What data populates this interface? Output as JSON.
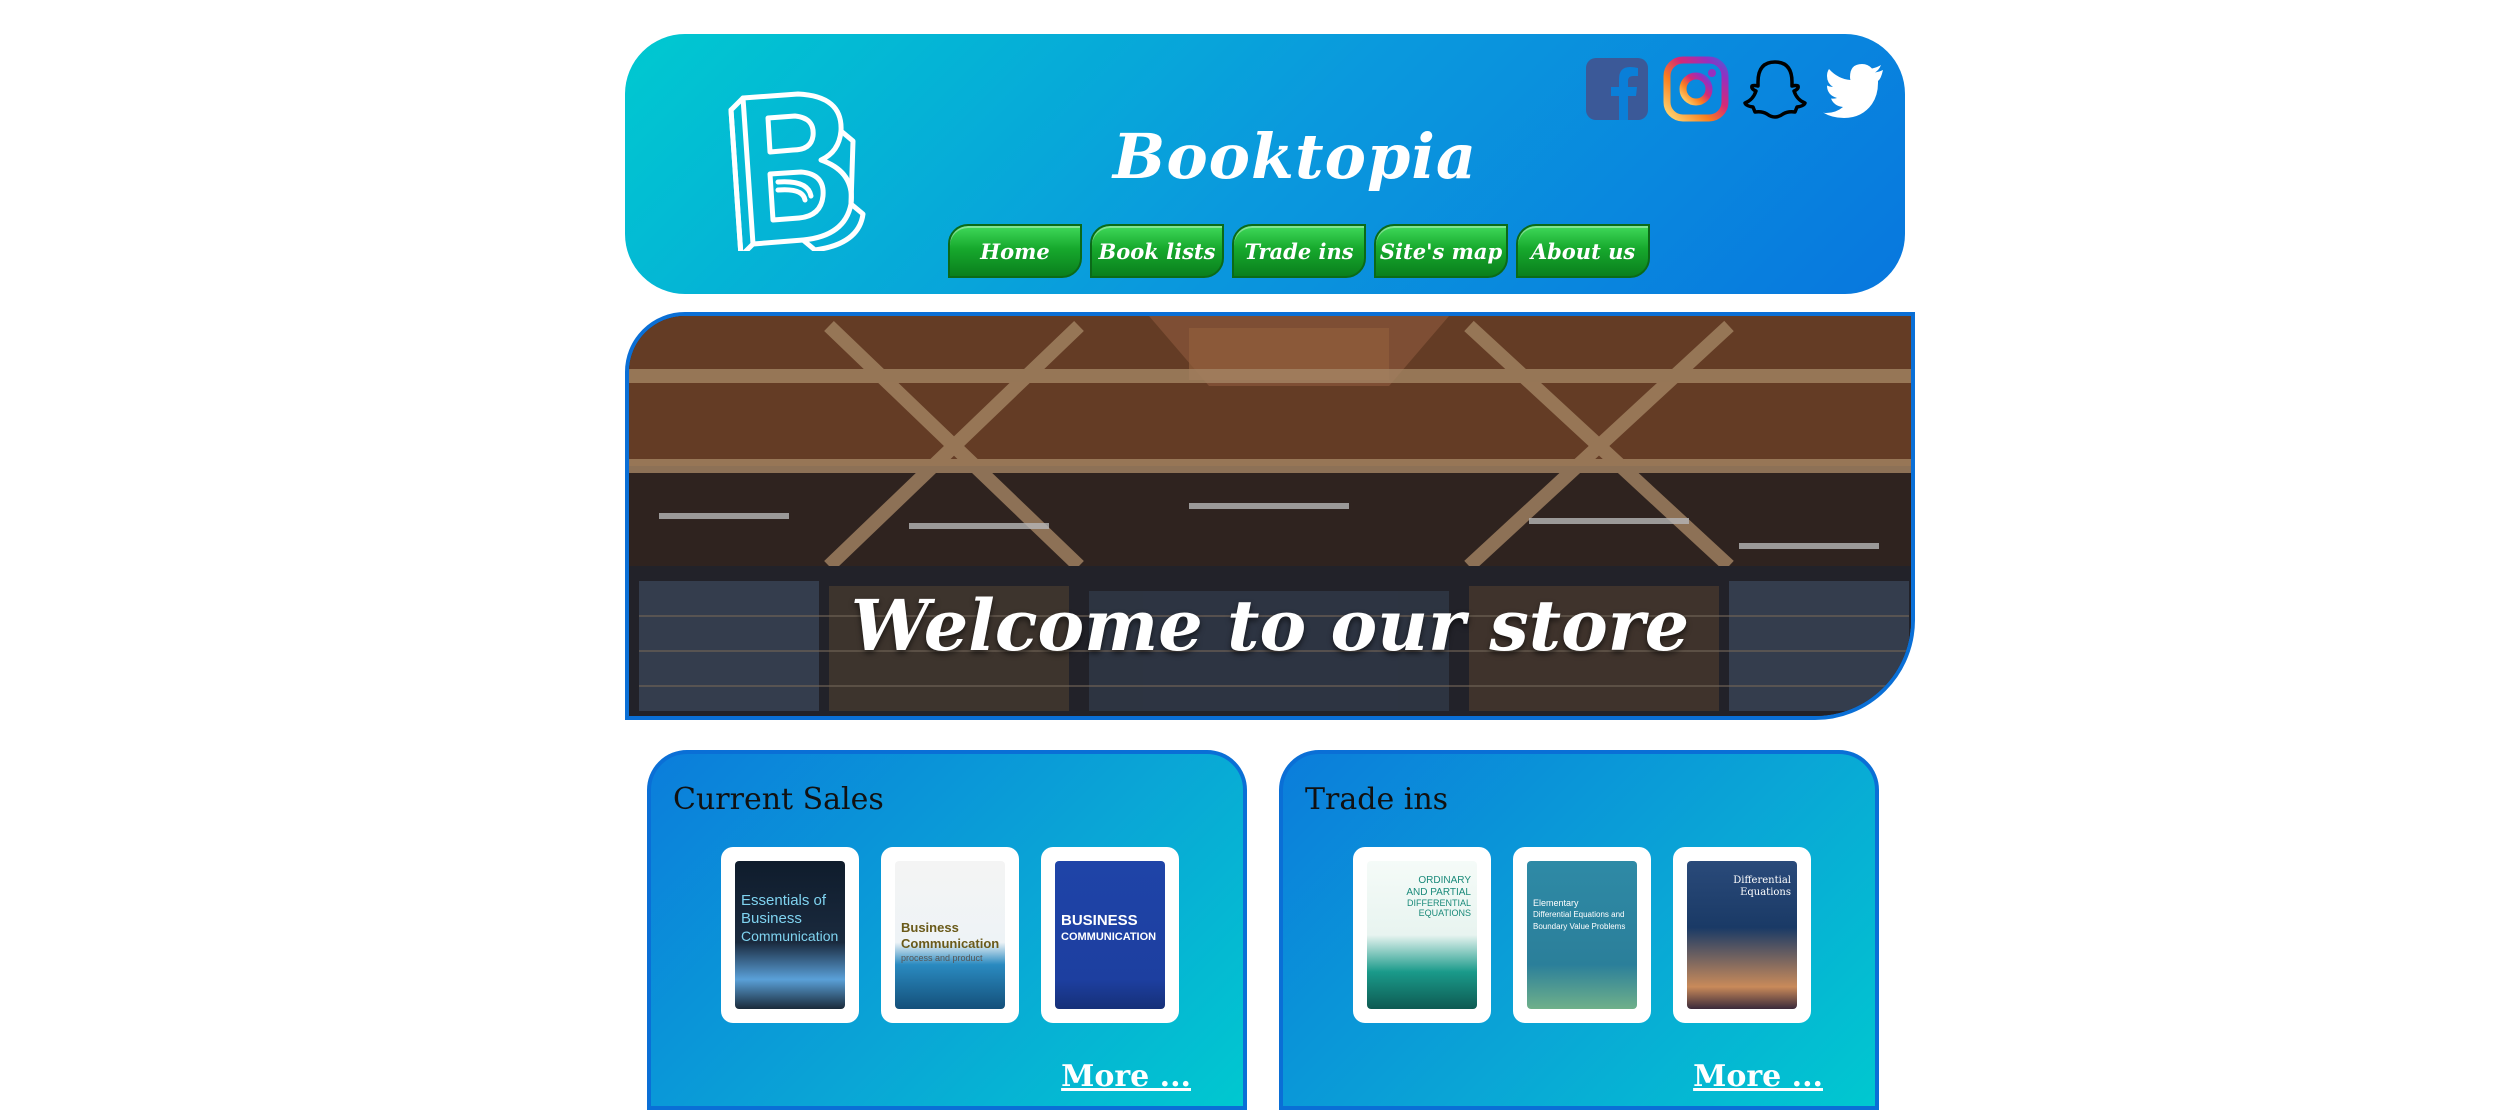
{
  "header": {
    "title": "Booktopia",
    "logo_icon": "book-b-logo-icon",
    "social": [
      {
        "name": "facebook-icon",
        "color": "#3b5998"
      },
      {
        "name": "instagram-icon",
        "color": "#c13584"
      },
      {
        "name": "snapchat-icon",
        "color": "#fffc00"
      },
      {
        "name": "twitter-icon",
        "color": "#ffffff"
      }
    ],
    "nav": [
      "Home",
      "Book lists",
      "Trade ins",
      "Site's map",
      "About us"
    ]
  },
  "hero": {
    "text": "Welcome to our store"
  },
  "sales": {
    "title": "Current Sales",
    "more": "More ...",
    "books": [
      {
        "title_line1": "Essentials of",
        "title_line2": "Business",
        "title_line3": "Communication",
        "color": "#1a2a3a"
      },
      {
        "title_line1": "Business",
        "title_line2": "Communication",
        "title_line3": "process and product",
        "color": "#f2f2f2"
      },
      {
        "title_line1": "BUSINESS",
        "title_line2": "COMMUNICATION",
        "title_line3": "",
        "color": "#1d3fa0"
      }
    ]
  },
  "trade": {
    "title": "Trade ins",
    "more": "More ...",
    "books": [
      {
        "title_line1": "ORDINARY",
        "title_line2": "AND PARTIAL",
        "title_line3": "DIFFERENTIAL EQUATIONS",
        "color": "#e8f4f0"
      },
      {
        "title_line1": "Elementary",
        "title_line2": "Differential Equations and",
        "title_line3": "Boundary Value Problems",
        "color": "#2b7f9a"
      },
      {
        "title_line1": "Differential",
        "title_line2": "Equations",
        "title_line3": "",
        "color": "#1a3a66"
      }
    ]
  },
  "colors": {
    "header_gradient_start": "#00c9d0",
    "header_gradient_end": "#0877de",
    "nav_green": "#17a92d",
    "panel_border": "#0a6fd6"
  }
}
